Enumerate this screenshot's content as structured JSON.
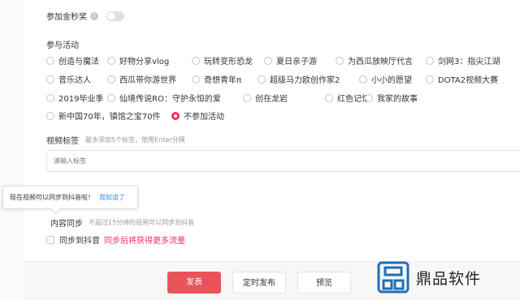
{
  "gold_award": {
    "label": "参加金秒奖",
    "help_icon": "?",
    "enabled": false
  },
  "activities": {
    "label": "参与活动",
    "rows": [
      [
        "创造与魔法",
        "好物分享vlog",
        "玩转变形恐龙",
        "夏日亲子游",
        "为西瓜放映厅代言",
        "剑网3：指尖江湖"
      ],
      [
        "音乐达人",
        "西瓜带你游世界",
        "奇想青年π",
        "超级马力欧创作家2",
        "小小的愿望",
        "DOTA2视频大赛"
      ],
      [
        "2019毕业季",
        "仙境传说RO：守护永恒的爱",
        "创在龙岩",
        "红色记忆",
        "我家的故事"
      ],
      [
        "新中国70年，镇馆之宝70件",
        "不参加活动"
      ]
    ],
    "selected": "不参加活动"
  },
  "video_tags": {
    "label": "视频标签",
    "hint": "最多添加5个标签，使用Enter分隔",
    "placeholder": "请输入标签"
  },
  "tooltip": {
    "text": "现在视频可以同步到抖音啦！",
    "link": "我知道了"
  },
  "content_sync": {
    "label": "内容同步",
    "hint": "不超过15分钟的视频可以同步到抖音",
    "checkbox_label": "同步到抖音",
    "promo": "同步后将获得更多流量"
  },
  "buttons": {
    "publish": "发表",
    "schedule": "定时发布",
    "preview": "预览"
  },
  "watermark": {
    "text": "鼎品软件"
  },
  "colors": {
    "accent": "#fe2c55",
    "publish_button": "#e9545b",
    "link": "#3b8ded"
  }
}
